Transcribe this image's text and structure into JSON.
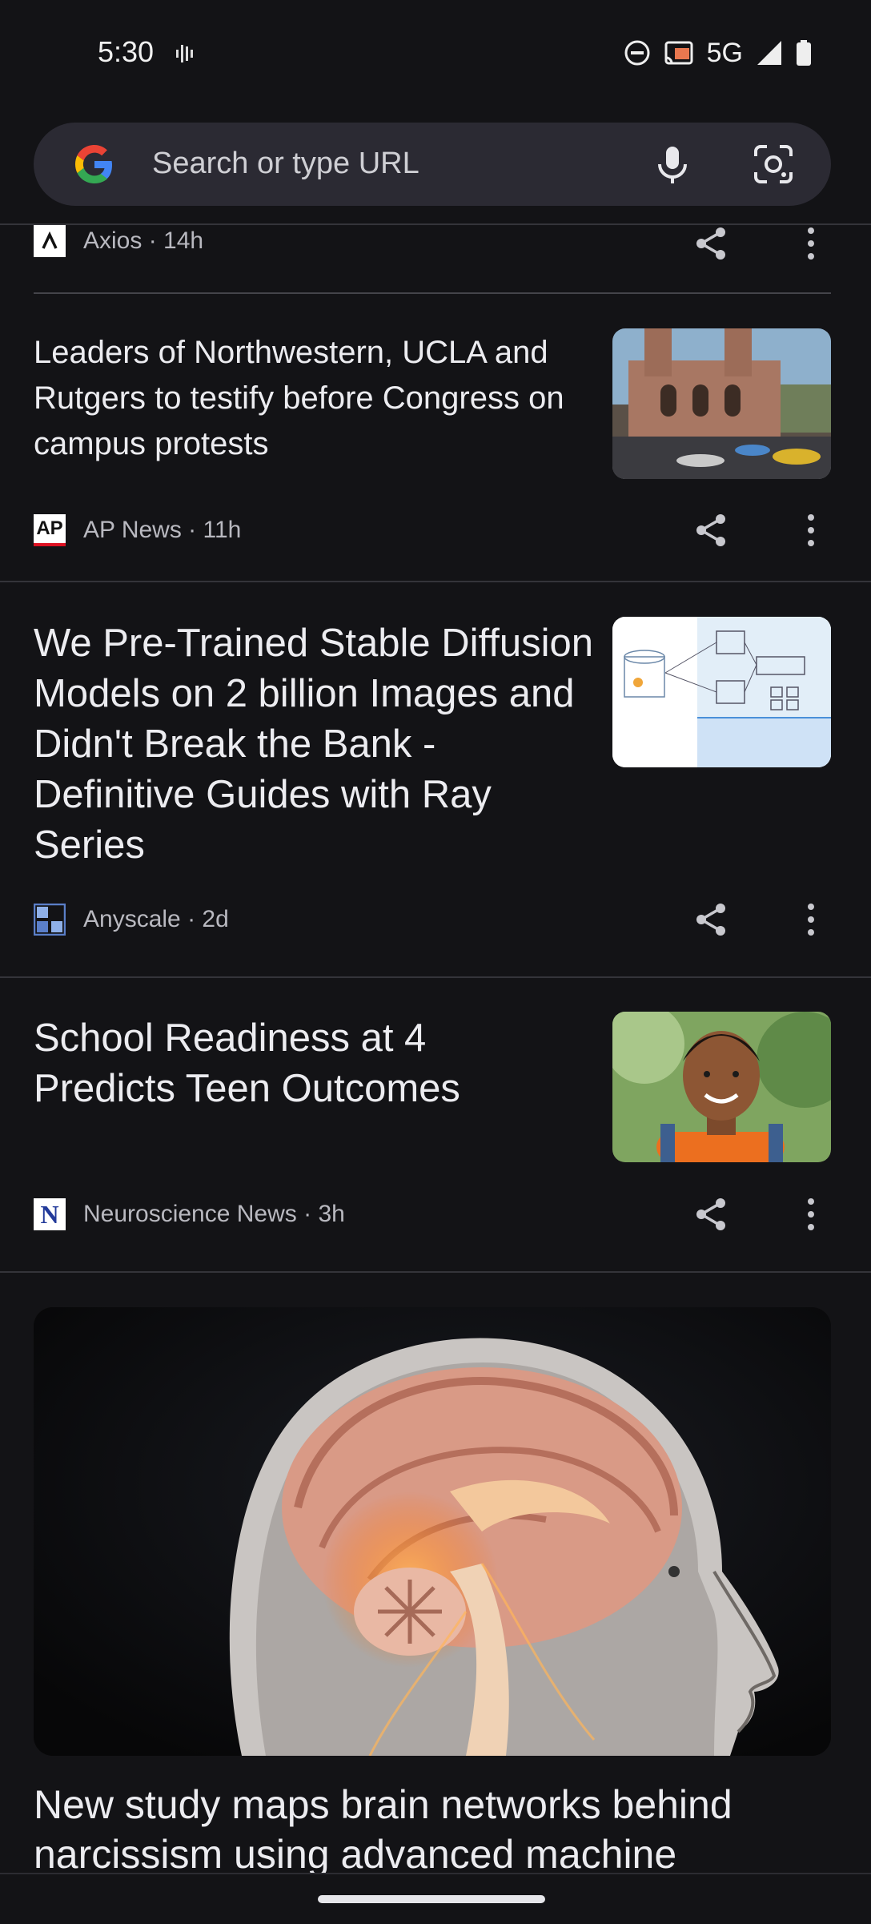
{
  "status_bar": {
    "time": "5:30",
    "network": "5G"
  },
  "search": {
    "placeholder": "Search or type URL"
  },
  "articles": [
    {
      "source": "Axios",
      "age": "14h"
    },
    {
      "title": "Leaders of Northwestern, UCLA and Rutgers to testify before Congress on campus protests",
      "source": "AP News",
      "age": "11h"
    },
    {
      "title": "We Pre-Trained Stable Diffusion Models on 2 billion Images and Didn't Break the Bank - Definitive Guides with Ray Series",
      "source": "Anyscale",
      "age": "2d"
    },
    {
      "title": "School Readiness at 4 Predicts Teen Outcomes",
      "source": "Neuroscience News",
      "age": "3h"
    },
    {
      "title": "New study maps brain networks behind narcissism using advanced machine"
    }
  ],
  "icons": {
    "share": "share-icon",
    "more": "more-vert-icon",
    "mic": "mic-icon",
    "lens": "google-lens-icon"
  },
  "colors": {
    "background": "#131316",
    "searchbar": "#2b2a33",
    "text": "#ececf0",
    "meta": "#b9b9c0"
  }
}
